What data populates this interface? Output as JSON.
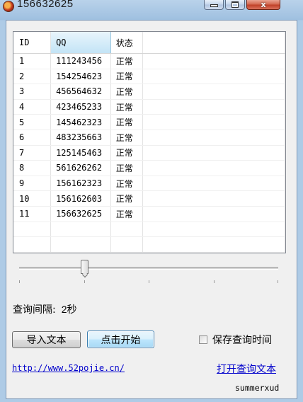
{
  "window": {
    "title": "156632625"
  },
  "table": {
    "columns": [
      "ID",
      "QQ",
      "状态"
    ],
    "rows": [
      {
        "id": "1",
        "qq": "111243456",
        "status": "正常"
      },
      {
        "id": "2",
        "qq": "154254623",
        "status": "正常"
      },
      {
        "id": "3",
        "qq": "456564632",
        "status": "正常"
      },
      {
        "id": "4",
        "qq": "423465233",
        "status": "正常"
      },
      {
        "id": "5",
        "qq": "145462323",
        "status": "正常"
      },
      {
        "id": "6",
        "qq": "483235663",
        "status": "正常"
      },
      {
        "id": "7",
        "qq": "125145463",
        "status": "正常"
      },
      {
        "id": "8",
        "qq": "561626262",
        "status": "正常"
      },
      {
        "id": "9",
        "qq": "156162323",
        "status": "正常"
      },
      {
        "id": "10",
        "qq": "156162603",
        "status": "正常"
      },
      {
        "id": "11",
        "qq": "156632625",
        "status": "正常"
      }
    ]
  },
  "slider": {
    "position_fraction": 0.25,
    "tick_count": 5
  },
  "interval": {
    "label": "查询间隔:",
    "value": "2秒"
  },
  "buttons": {
    "import": "导入文本",
    "start": "点击开始"
  },
  "checkbox": {
    "label": "保存查询时间",
    "checked": false
  },
  "links": {
    "site": "http://www.52pojie.cn/",
    "open_file": "打开查询文本"
  },
  "author": "summerxud"
}
